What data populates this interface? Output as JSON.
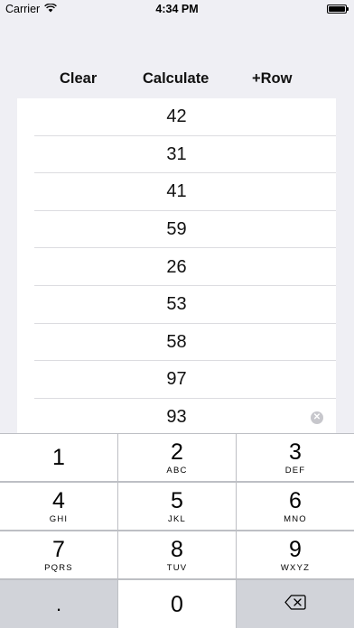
{
  "status_bar": {
    "carrier": "Carrier",
    "time": "4:34 PM",
    "wifi_icon": "wifi-icon",
    "battery_icon": "battery-icon"
  },
  "toolbar": {
    "clear_label": "Clear",
    "calculate_label": "Calculate",
    "add_row_label": "+Row"
  },
  "rows": [
    "42",
    "31",
    "41",
    "59",
    "26",
    "53",
    "58",
    "97"
  ],
  "active_input": {
    "value": "93",
    "clear_icon": "clear-circle-icon"
  },
  "keypad": {
    "keys": [
      {
        "digit": "1",
        "letters": ""
      },
      {
        "digit": "2",
        "letters": "ABC"
      },
      {
        "digit": "3",
        "letters": "DEF"
      },
      {
        "digit": "4",
        "letters": "GHI"
      },
      {
        "digit": "5",
        "letters": "JKL"
      },
      {
        "digit": "6",
        "letters": "MNO"
      },
      {
        "digit": "7",
        "letters": "PQRS"
      },
      {
        "digit": "8",
        "letters": "TUV"
      },
      {
        "digit": "9",
        "letters": "WXYZ"
      },
      {
        "digit": ".",
        "letters": ""
      },
      {
        "digit": "0",
        "letters": ""
      },
      {
        "digit": "",
        "letters": "",
        "icon": "backspace-icon"
      }
    ]
  },
  "colors": {
    "background": "#efeff4",
    "keypad_background": "#bdbfc4",
    "key_light": "#ffffff",
    "key_dark": "#d1d3d9"
  }
}
